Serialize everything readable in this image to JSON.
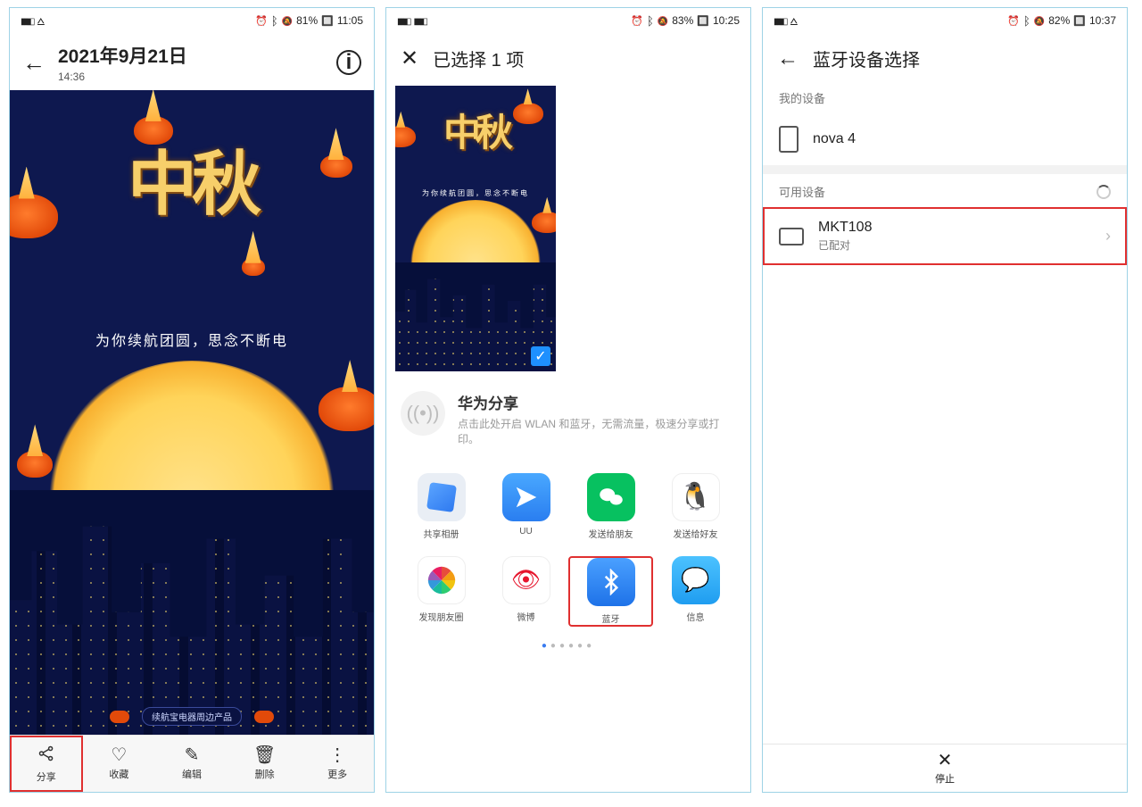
{
  "screen1": {
    "status": {
      "battery": "81%",
      "time": "11:05"
    },
    "header": {
      "date": "2021年9月21日",
      "time": "14:36"
    },
    "image": {
      "title": "中秋",
      "tagline": "为你续航团圆，思念不断电",
      "footer_chip": "续航宝电器周边产品"
    },
    "bottombar": [
      {
        "key": "share",
        "icon": "share-icon",
        "label": "分享"
      },
      {
        "key": "fav",
        "icon": "heart-icon",
        "label": "收藏"
      },
      {
        "key": "edit",
        "icon": "edit-icon",
        "label": "编辑"
      },
      {
        "key": "delete",
        "icon": "trash-icon",
        "label": "删除"
      },
      {
        "key": "more",
        "icon": "more-icon",
        "label": "更多"
      }
    ]
  },
  "screen2": {
    "status": {
      "battery": "83%",
      "time": "10:25"
    },
    "header_title": "已选择 1 项",
    "huawei_share": {
      "title": "华为分享",
      "desc": "点击此处开启 WLAN 和蓝牙，无需流量，极速分享或打印。"
    },
    "apps_row1": [
      {
        "key": "folder",
        "label": "共享相册"
      },
      {
        "key": "uu",
        "label": "UU"
      },
      {
        "key": "wechat",
        "label": "发送给朋友"
      },
      {
        "key": "qq",
        "label": "发送给好友"
      }
    ],
    "apps_row2": [
      {
        "key": "moments",
        "label": "发现朋友圈"
      },
      {
        "key": "weibo",
        "label": "微博"
      },
      {
        "key": "bt",
        "label": "蓝牙"
      },
      {
        "key": "msg",
        "label": "信息"
      }
    ]
  },
  "screen3": {
    "status": {
      "battery": "82%",
      "time": "10:37"
    },
    "header_title": "蓝牙设备选择",
    "my_devices_label": "我的设备",
    "my_device_name": "nova 4",
    "available_label": "可用设备",
    "target": {
      "name": "MKT108",
      "status": "已配对"
    },
    "stop_label": "停止"
  }
}
